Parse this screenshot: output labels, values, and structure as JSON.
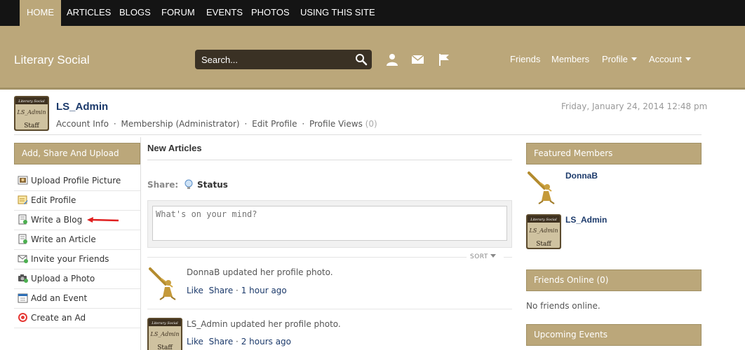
{
  "topnav": {
    "items": [
      {
        "label": "HOME",
        "active": true
      },
      {
        "label": "ARTICLES"
      },
      {
        "label": "BLOGS"
      },
      {
        "label": "FORUM"
      },
      {
        "label": "EVENTS"
      },
      {
        "label": "PHOTOS"
      },
      {
        "label": "USING THIS SITE"
      }
    ]
  },
  "header": {
    "site_title": "Literary Social",
    "search_placeholder": "Search...",
    "links": [
      {
        "label": "Friends"
      },
      {
        "label": "Members"
      },
      {
        "label": "Profile"
      },
      {
        "label": "Account"
      }
    ],
    "icons": [
      "user-icon",
      "mail-icon",
      "flag-icon",
      "search-icon"
    ]
  },
  "profile": {
    "username": "LS_Admin",
    "avatar_text": {
      "line1": "Literary Social",
      "line2": "LS_Admin",
      "line3": "Staff"
    },
    "links": {
      "account_info": "Account Info",
      "membership": "Membership (Administrator)",
      "edit_profile": "Edit Profile",
      "profile_views": "Profile Views",
      "profile_views_count": "(0)",
      "separator": "·"
    },
    "datetime": "Friday, January 24, 2014 12:48 pm"
  },
  "left": {
    "title": "Add, Share And Upload",
    "items": [
      {
        "label": "Upload Profile Picture",
        "icon": "picture-icon"
      },
      {
        "label": "Edit Profile",
        "icon": "edit-profile-icon"
      },
      {
        "label": "Write a Blog",
        "icon": "blog-icon"
      },
      {
        "label": "Write an Article",
        "icon": "article-icon"
      },
      {
        "label": "Invite your Friends",
        "icon": "invite-icon"
      },
      {
        "label": "Upload a Photo",
        "icon": "camera-icon"
      },
      {
        "label": "Add an Event",
        "icon": "calendar-icon"
      },
      {
        "label": "Create an Ad",
        "icon": "target-icon"
      }
    ]
  },
  "center": {
    "title": "New Articles",
    "share_label": "Share:",
    "status_label": "Status",
    "status_placeholder": "What's on your mind?",
    "sort_label": "SORT",
    "feed": [
      {
        "text": "DonnaB updated her profile photo.",
        "like": "Like",
        "share": "Share",
        "sep": "·",
        "time": "1 hour ago"
      },
      {
        "text": "LS_Admin updated her profile photo.",
        "like": "Like",
        "share": "Share",
        "sep": "·",
        "time": "2 hours ago"
      }
    ]
  },
  "right": {
    "featured_title": "Featured Members",
    "members": [
      {
        "name": "DonnaB"
      },
      {
        "name": "LS_Admin"
      }
    ],
    "online_title": "Friends Online (0)",
    "no_friends": "No friends online.",
    "events_title": "Upcoming Events"
  },
  "colors": {
    "accent": "#bba77a",
    "nav_bg": "#141414",
    "link": "#1c3a6b",
    "annotation_arrow": "#e02020"
  }
}
